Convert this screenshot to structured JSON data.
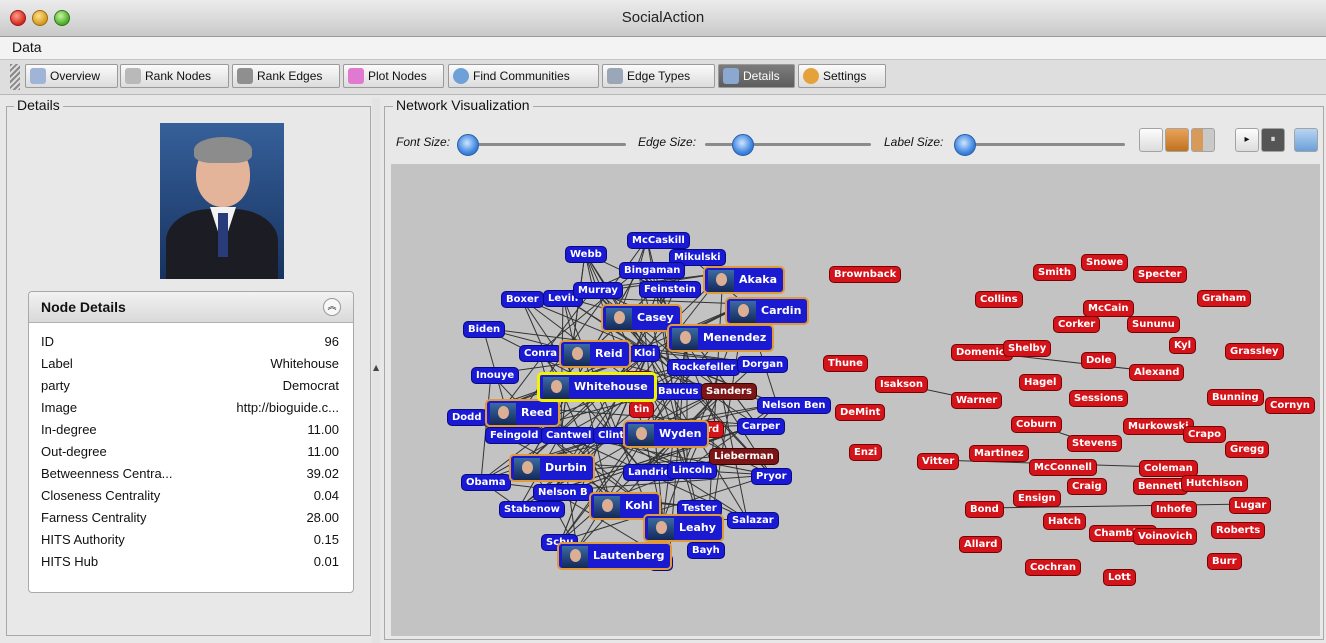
{
  "window": {
    "title": "SocialAction"
  },
  "menu": {
    "data_label": "Data"
  },
  "tabs": [
    {
      "label": "Overview",
      "icon": "overview-icon",
      "color": "#9fb4d6"
    },
    {
      "label": "Rank Nodes",
      "icon": "rank-nodes-icon",
      "color": "#b9b9b9"
    },
    {
      "label": "Rank Edges",
      "icon": "rank-edges-icon",
      "color": "#8f8f8f"
    },
    {
      "label": "Plot Nodes",
      "icon": "plot-nodes-icon",
      "color": "#e07ad0"
    },
    {
      "label": "Find Communities",
      "icon": "find-communities-icon",
      "color": "#6fa0d8"
    },
    {
      "label": "Edge Types",
      "icon": "edge-types-icon",
      "color": "#9aa7b8"
    },
    {
      "label": "Details",
      "icon": "details-icon",
      "color": "#8aa8d0"
    },
    {
      "label": "Settings",
      "icon": "settings-icon",
      "color": "#e5a23a"
    }
  ],
  "details": {
    "legend": "Details",
    "node_details": {
      "title": "Node Details",
      "rows": [
        {
          "key": "ID",
          "value": "96"
        },
        {
          "key": "Label",
          "value": "Whitehouse"
        },
        {
          "key": "party",
          "value": "Democrat"
        },
        {
          "key": "Image",
          "value": "http://bioguide.c..."
        },
        {
          "key": "In-degree",
          "value": "11.00"
        },
        {
          "key": "Out-degree",
          "value": "11.00"
        },
        {
          "key": "Betweenness Centra...",
          "value": "39.02"
        },
        {
          "key": "Closeness Centrality",
          "value": "0.04"
        },
        {
          "key": "Farness Centrality",
          "value": "28.00"
        },
        {
          "key": "HITS Authority",
          "value": "0.15"
        },
        {
          "key": "HITS Hub",
          "value": "0.01"
        }
      ]
    }
  },
  "network": {
    "legend": "Network Visualization",
    "font_size_label": "Font Size:",
    "edge_size_label": "Edge Size:",
    "label_size_label": "Label Size:",
    "font_size_value": 0.04,
    "edge_size_value": 0.22,
    "label_size_value": 0.05,
    "colors": {
      "democrat": "#1919d6",
      "republican": "#d3141a",
      "independent": "#7c1616",
      "selected_border": "#f3f300",
      "photo_border": "#e19a39"
    },
    "blue_nodes": [
      "McCaskill",
      "Webb",
      "Mikulski",
      "Bingaman",
      "Boxer",
      "Levin",
      "Murray",
      "Feinstein",
      "Biden",
      "Conra",
      "Kloi",
      "Inouye",
      "Rockefeller",
      "Dorgan",
      "Baucus",
      "Dodd",
      "Feingold",
      "Cantwel",
      "Clint",
      "Carper",
      "Nelson Ben",
      "Obama",
      "Nelson B",
      "Landrie",
      "Lincoln",
      "Tester",
      "Stabenow",
      "Salazar",
      "Bayh",
      "Pryor",
      "Schu",
      "vn"
    ],
    "photo_nodes": [
      "Akaka",
      "Cardin",
      "Casey",
      "Menendez",
      "Reid",
      "Reed",
      "Wyden",
      "Durbin",
      "Kohl",
      "Leahy",
      "Lautenberg"
    ],
    "selected_node": "Whitehouse",
    "dark_nodes": [
      "Sanders",
      "Lieberman"
    ],
    "red_nodes": [
      "Brownback",
      "Snowe",
      "Smith",
      "Specter",
      "Collins",
      "McCain",
      "Graham",
      "Corker",
      "Sununu",
      "Domenici",
      "Shelby",
      "Kyl",
      "Grassley",
      "Dole",
      "Alexand",
      "Thune",
      "Isakson",
      "DeMint",
      "Hagel",
      "Cornyn",
      "Warner",
      "Sessions",
      "Bunning",
      "Coburn",
      "Murkowski",
      "Crapo",
      "Stevens",
      "Gregg",
      "Enzi",
      "Martinez",
      "Vitter",
      "McConnell",
      "Coleman",
      "Craig",
      "Bennett",
      "Hutchison",
      "Ensign",
      "Bond",
      "Lugar",
      "Hatch",
      "Inhofe",
      "Chambliss",
      "Roberts",
      "Allard",
      "Voinovich",
      "Burr",
      "Cochran",
      "Lott",
      "ned",
      "tin",
      "urd"
    ]
  }
}
